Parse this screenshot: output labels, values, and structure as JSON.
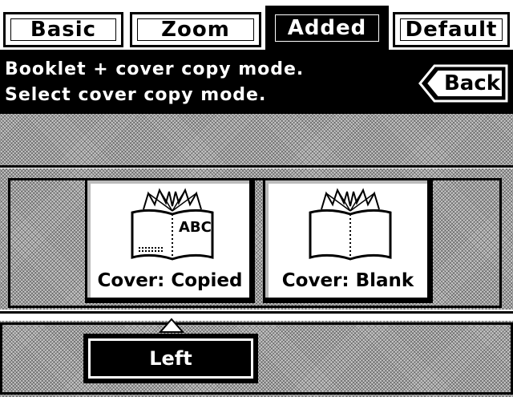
{
  "tabs": [
    {
      "label": "Basic",
      "active": false
    },
    {
      "label": "Zoom",
      "active": false
    },
    {
      "label": "Added",
      "active": true
    },
    {
      "label": "Default",
      "active": false
    }
  ],
  "message": {
    "line1": "Booklet + cover copy mode.",
    "line2": "Select cover copy mode."
  },
  "back_button": {
    "label": "Back"
  },
  "mode_buttons": [
    {
      "label": "Cover: Copied",
      "icon": "open-book-abc-icon",
      "icon_text": "ABC"
    },
    {
      "label": "Cover: Blank",
      "icon": "open-book-blank-icon"
    }
  ],
  "position_button": {
    "label": "Left"
  }
}
